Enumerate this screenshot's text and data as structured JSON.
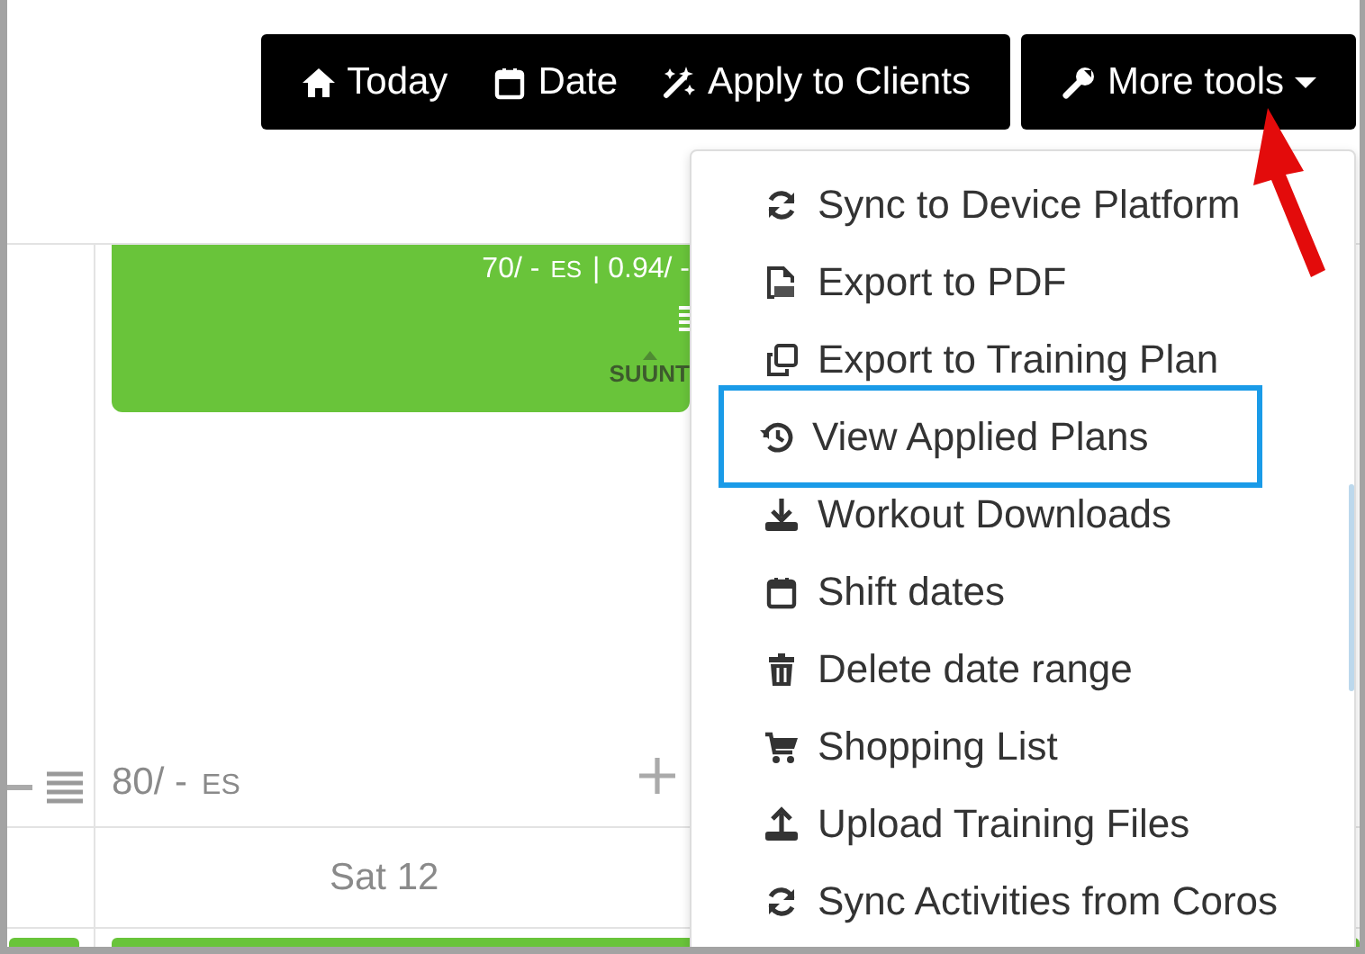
{
  "toolbar": {
    "buttons": [
      {
        "kind": "home",
        "label": "Today"
      },
      {
        "kind": "calendar",
        "label": "Date"
      },
      {
        "kind": "wand",
        "label": "Apply to Clients"
      }
    ],
    "more_tools": {
      "label": "More tools",
      "expanded": true
    }
  },
  "calendar": {
    "workout_card": {
      "summary": "70/ -",
      "unit": "ES",
      "extra": "| 0.94/ -",
      "source": "SUUNT"
    },
    "week_total": {
      "summary": "80/ -",
      "unit": "ES"
    },
    "day_label": "Sat 12"
  },
  "menu": {
    "items": [
      {
        "kind": "sync",
        "label": "Sync to Device Platform",
        "selected": false
      },
      {
        "kind": "pdf",
        "label": "Export to PDF",
        "selected": false
      },
      {
        "kind": "copy",
        "label": "Export to Training Plan",
        "selected": false
      },
      {
        "kind": "history",
        "label": "View Applied Plans",
        "selected": true
      },
      {
        "kind": "download",
        "label": "Workout Downloads",
        "selected": false
      },
      {
        "kind": "calendar",
        "label": "Shift dates",
        "selected": false
      },
      {
        "kind": "trash",
        "label": "Delete date range",
        "selected": false
      },
      {
        "kind": "cart",
        "label": "Shopping List",
        "selected": false
      },
      {
        "kind": "upload",
        "label": "Upload Training Files",
        "selected": false
      },
      {
        "kind": "sync",
        "label": "Sync Activities from Coros",
        "selected": false
      }
    ]
  }
}
